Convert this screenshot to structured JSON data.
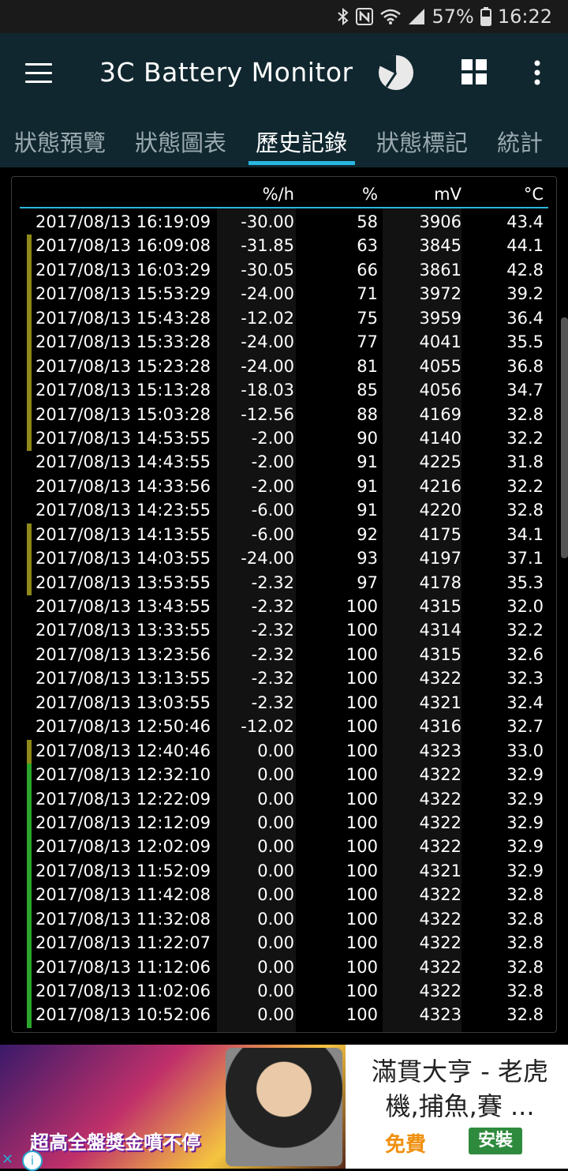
{
  "status_bar": {
    "battery": "57%",
    "time": "16:22",
    "icons": [
      "bluetooth-icon",
      "nfc-icon",
      "wifi-icon",
      "signal-icon",
      "battery-icon"
    ]
  },
  "app": {
    "title": "3C Battery Monitor",
    "icons": [
      "menu-icon",
      "pie-chart-icon",
      "grid-icon",
      "more-vert-icon"
    ]
  },
  "tabs": [
    {
      "label": "狀態預覽"
    },
    {
      "label": "狀態圖表"
    },
    {
      "label": "歷史記錄"
    },
    {
      "label": "狀態標記"
    },
    {
      "label": "統計"
    }
  ],
  "active_tab": 2,
  "table": {
    "headers": {
      "rate": "%/h",
      "pct": "%",
      "mv": "mV",
      "temp": "°C"
    },
    "rows": [
      {
        "date": "2017/08/13 16:19:09",
        "rate": "-30.00",
        "pct": "58",
        "mv": "3906",
        "temp": "43.4",
        "marker": "none"
      },
      {
        "date": "2017/08/13 16:09:08",
        "rate": "-31.85",
        "pct": "63",
        "mv": "3845",
        "temp": "44.1",
        "marker": "olive"
      },
      {
        "date": "2017/08/13 16:03:29",
        "rate": "-30.05",
        "pct": "66",
        "mv": "3861",
        "temp": "42.8",
        "marker": "olive"
      },
      {
        "date": "2017/08/13 15:53:29",
        "rate": "-24.00",
        "pct": "71",
        "mv": "3972",
        "temp": "39.2",
        "marker": "olive"
      },
      {
        "date": "2017/08/13 15:43:28",
        "rate": "-12.02",
        "pct": "75",
        "mv": "3959",
        "temp": "36.4",
        "marker": "olive"
      },
      {
        "date": "2017/08/13 15:33:28",
        "rate": "-24.00",
        "pct": "77",
        "mv": "4041",
        "temp": "35.5",
        "marker": "olive"
      },
      {
        "date": "2017/08/13 15:23:28",
        "rate": "-24.00",
        "pct": "81",
        "mv": "4055",
        "temp": "36.8",
        "marker": "olive"
      },
      {
        "date": "2017/08/13 15:13:28",
        "rate": "-18.03",
        "pct": "85",
        "mv": "4056",
        "temp": "34.7",
        "marker": "olive"
      },
      {
        "date": "2017/08/13 15:03:28",
        "rate": "-12.56",
        "pct": "88",
        "mv": "4169",
        "temp": "32.8",
        "marker": "olive"
      },
      {
        "date": "2017/08/13 14:53:55",
        "rate": "-2.00",
        "pct": "90",
        "mv": "4140",
        "temp": "32.2",
        "marker": "olive"
      },
      {
        "date": "2017/08/13 14:43:55",
        "rate": "-2.00",
        "pct": "91",
        "mv": "4225",
        "temp": "31.8",
        "marker": "none"
      },
      {
        "date": "2017/08/13 14:33:56",
        "rate": "-2.00",
        "pct": "91",
        "mv": "4216",
        "temp": "32.2",
        "marker": "none"
      },
      {
        "date": "2017/08/13 14:23:55",
        "rate": "-6.00",
        "pct": "91",
        "mv": "4220",
        "temp": "32.8",
        "marker": "none"
      },
      {
        "date": "2017/08/13 14:13:55",
        "rate": "-6.00",
        "pct": "92",
        "mv": "4175",
        "temp": "34.1",
        "marker": "olive"
      },
      {
        "date": "2017/08/13 14:03:55",
        "rate": "-24.00",
        "pct": "93",
        "mv": "4197",
        "temp": "37.1",
        "marker": "olive"
      },
      {
        "date": "2017/08/13 13:53:55",
        "rate": "-2.32",
        "pct": "97",
        "mv": "4178",
        "temp": "35.3",
        "marker": "olive"
      },
      {
        "date": "2017/08/13 13:43:55",
        "rate": "-2.32",
        "pct": "100",
        "mv": "4315",
        "temp": "32.0",
        "marker": "none"
      },
      {
        "date": "2017/08/13 13:33:55",
        "rate": "-2.32",
        "pct": "100",
        "mv": "4314",
        "temp": "32.2",
        "marker": "none"
      },
      {
        "date": "2017/08/13 13:23:56",
        "rate": "-2.32",
        "pct": "100",
        "mv": "4315",
        "temp": "32.6",
        "marker": "none"
      },
      {
        "date": "2017/08/13 13:13:55",
        "rate": "-2.32",
        "pct": "100",
        "mv": "4322",
        "temp": "32.3",
        "marker": "none"
      },
      {
        "date": "2017/08/13 13:03:55",
        "rate": "-2.32",
        "pct": "100",
        "mv": "4321",
        "temp": "32.4",
        "marker": "none"
      },
      {
        "date": "2017/08/13 12:50:46",
        "rate": "-12.02",
        "pct": "100",
        "mv": "4316",
        "temp": "32.7",
        "marker": "none"
      },
      {
        "date": "2017/08/13 12:40:46",
        "rate": "0.00",
        "pct": "100",
        "mv": "4323",
        "temp": "33.0",
        "marker": "olive"
      },
      {
        "date": "2017/08/13 12:32:10",
        "rate": "0.00",
        "pct": "100",
        "mv": "4322",
        "temp": "32.9",
        "marker": "green"
      },
      {
        "date": "2017/08/13 12:22:09",
        "rate": "0.00",
        "pct": "100",
        "mv": "4322",
        "temp": "32.9",
        "marker": "green"
      },
      {
        "date": "2017/08/13 12:12:09",
        "rate": "0.00",
        "pct": "100",
        "mv": "4322",
        "temp": "32.9",
        "marker": "green"
      },
      {
        "date": "2017/08/13 12:02:09",
        "rate": "0.00",
        "pct": "100",
        "mv": "4322",
        "temp": "32.9",
        "marker": "green"
      },
      {
        "date": "2017/08/13 11:52:09",
        "rate": "0.00",
        "pct": "100",
        "mv": "4321",
        "temp": "32.9",
        "marker": "green"
      },
      {
        "date": "2017/08/13 11:42:08",
        "rate": "0.00",
        "pct": "100",
        "mv": "4322",
        "temp": "32.8",
        "marker": "green"
      },
      {
        "date": "2017/08/13 11:32:08",
        "rate": "0.00",
        "pct": "100",
        "mv": "4322",
        "temp": "32.8",
        "marker": "green"
      },
      {
        "date": "2017/08/13 11:22:07",
        "rate": "0.00",
        "pct": "100",
        "mv": "4322",
        "temp": "32.8",
        "marker": "green"
      },
      {
        "date": "2017/08/13 11:12:06",
        "rate": "0.00",
        "pct": "100",
        "mv": "4322",
        "temp": "32.8",
        "marker": "green"
      },
      {
        "date": "2017/08/13 11:02:06",
        "rate": "0.00",
        "pct": "100",
        "mv": "4322",
        "temp": "32.8",
        "marker": "green"
      },
      {
        "date": "2017/08/13 10:52:06",
        "rate": "0.00",
        "pct": "100",
        "mv": "4323",
        "temp": "32.8",
        "marker": "green"
      }
    ]
  },
  "colors": {
    "appbar": "#10272f",
    "accent": "#29b6e0",
    "marker_olive": "#8f8a1a",
    "marker_green": "#2ba52b",
    "column_shade": "#121212"
  },
  "ad": {
    "image_caption": "超高全盤獎金噴不停",
    "title": "滿貫大亨 - 老虎機,捕魚,賽 ...",
    "price": "免費",
    "install_label": "安裝",
    "close_glyph": "✕",
    "info_glyph": "i"
  }
}
